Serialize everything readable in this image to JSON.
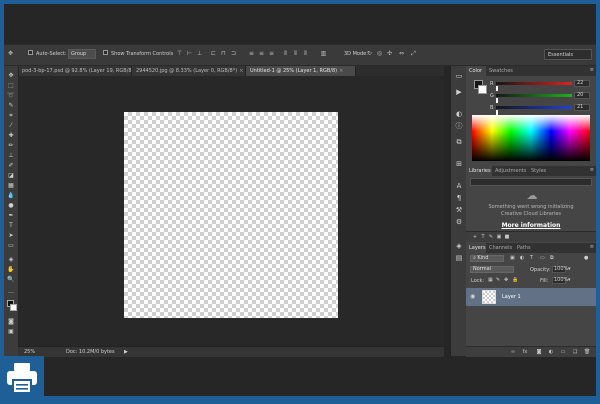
{
  "options_bar": {
    "auto_select_label": "Auto-Select:",
    "auto_select_target": "Group",
    "show_transform_label": "Show Transform Controls",
    "mode_3d_label": "3D Mode:",
    "workspace": "Essentials"
  },
  "tabs": [
    {
      "label": "pod-3-bp-17.psd @ 92.8% (Layer 19, RGB/8)",
      "close": "×"
    },
    {
      "label": "2944520.jpg @ 8.33% (Layer 0, RGB/8*)",
      "close": "×"
    },
    {
      "label": "Untitled-1 @ 25% (Layer 1, RGB/8)",
      "close": "×"
    }
  ],
  "status": {
    "zoom": "25%",
    "doc_info": "Doc: 10.2M/0 bytes",
    "arrow": "▶"
  },
  "color_panel": {
    "tabs": [
      "Color",
      "Swatches"
    ],
    "sliders": [
      {
        "label": "R",
        "value": "22",
        "color": "#e02020"
      },
      {
        "label": "G",
        "value": "20",
        "color": "#20b020"
      },
      {
        "label": "B",
        "value": "21",
        "color": "#2040e0"
      }
    ]
  },
  "libraries_panel": {
    "tabs": [
      "Libraries",
      "Adjustments",
      "Styles"
    ],
    "message_line1": "Something went wrong initializing",
    "message_line2": "Creative Cloud Libraries",
    "link": "More information"
  },
  "layers_panel": {
    "tabs": [
      "Layers",
      "Channels",
      "Paths"
    ],
    "kind_filter": "Kind",
    "blend_mode": "Normal",
    "opacity_label": "Opacity:",
    "opacity_value": "100%",
    "lock_label": "Lock:",
    "fill_label": "Fill:",
    "fill_value": "100%",
    "layers": [
      {
        "name": "Layer 1"
      }
    ]
  }
}
